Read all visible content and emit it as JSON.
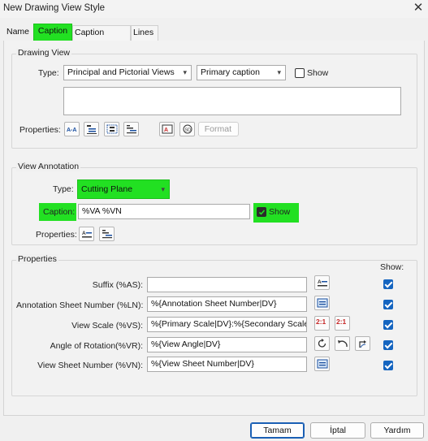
{
  "window": {
    "title": "New Drawing View Style",
    "close_glyph": "✕"
  },
  "tabs": [
    {
      "label": "Name"
    },
    {
      "label": "Caption"
    },
    {
      "label": "Caption Format"
    },
    {
      "label": "Lines"
    }
  ],
  "drawing_view": {
    "group_title": "Drawing View",
    "type_label": "Type:",
    "type_value": "Principal and Pictorial Views",
    "caption_value": "Primary caption",
    "show_label": "Show",
    "show_checked": false,
    "caption_text": "",
    "properties_label": "Properties:",
    "format_label": "Format"
  },
  "view_annotation": {
    "group_title": "View Annotation",
    "type_label": "Type:",
    "type_value": "Cutting Plane",
    "caption_label": "Caption:",
    "caption_value": "%VA %VN",
    "show_label": "Show",
    "show_checked": true,
    "properties_label": "Properties:"
  },
  "properties": {
    "group_title": "Properties",
    "show_header": "Show:",
    "rows": [
      {
        "label": "Suffix (%AS):",
        "value": "",
        "checked": true
      },
      {
        "label": "Annotation Sheet Number (%LN):",
        "value": "%{Annotation Sheet Number|DV}",
        "checked": true
      },
      {
        "label": "View Scale (%VS):",
        "value": "%{Primary Scale|DV}:%{Secondary Scale|DV",
        "checked": true
      },
      {
        "label": "Angle of Rotation(%VR):",
        "value": "%{View Angle|DV}",
        "checked": true
      },
      {
        "label": "View Sheet Number (%VN):",
        "value": "%{View Sheet Number|DV}",
        "checked": true
      }
    ],
    "scale_icon_text": "2:1"
  },
  "buttons": {
    "ok": "Tamam",
    "cancel": "İptal",
    "help": "Yardım"
  },
  "colors": {
    "highlight": "#22e022",
    "accent": "#1565c0"
  }
}
